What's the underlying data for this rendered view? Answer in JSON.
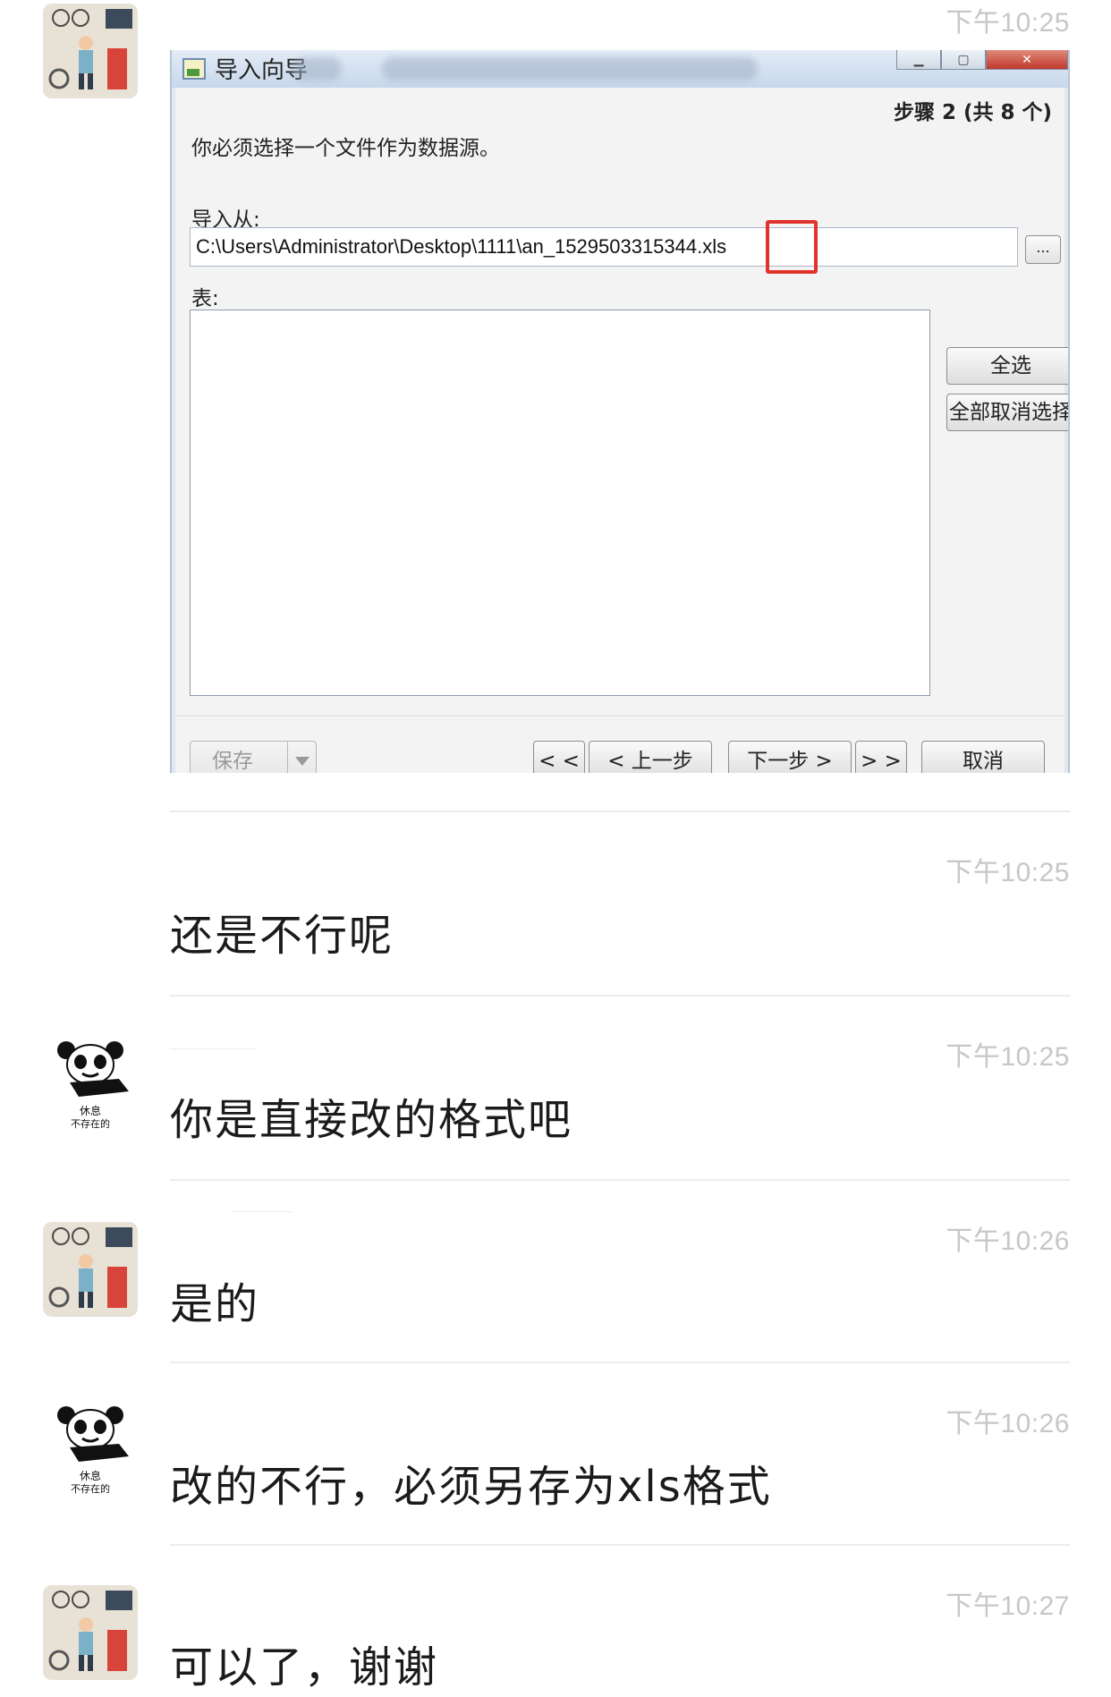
{
  "dialog": {
    "title": "导入向导",
    "step": "步骤 2 (共 8 个)",
    "instruction": "你必须选择一个文件作为数据源。",
    "import_from_label": "导入从:",
    "file_path": "C:\\Users\\Administrator\\Desktop\\1111\\an_1529503315344.xls",
    "browse_label": "...",
    "table_label": "表:",
    "select_all": "全选",
    "deselect_all": "全部取消选择",
    "save_label": "保存",
    "first_label": "< <",
    "prev_label": "< 上一步",
    "next_label": "下一步 >",
    "last_label": "> >",
    "cancel_label": "取消",
    "highlight_color": "#e0332d"
  },
  "messages": [
    {
      "sender": "user-photo",
      "time": "下午10:25",
      "kind": "image"
    },
    {
      "sender": "user-photo",
      "time": "下午10:25",
      "text": "还是不行呢"
    },
    {
      "sender": "panda",
      "time": "下午10:25",
      "text": "你是直接改的格式吧"
    },
    {
      "sender": "user-photo",
      "time": "下午10:26",
      "text": "是的"
    },
    {
      "sender": "panda",
      "time": "下午10:26",
      "text": "改的不行，必须另存为xls格式"
    },
    {
      "sender": "user-photo",
      "time": "下午10:27",
      "text": "可以了，谢谢"
    }
  ],
  "panda_avatar": {
    "caption_top": "休息",
    "caption_bottom": "不存在的"
  }
}
